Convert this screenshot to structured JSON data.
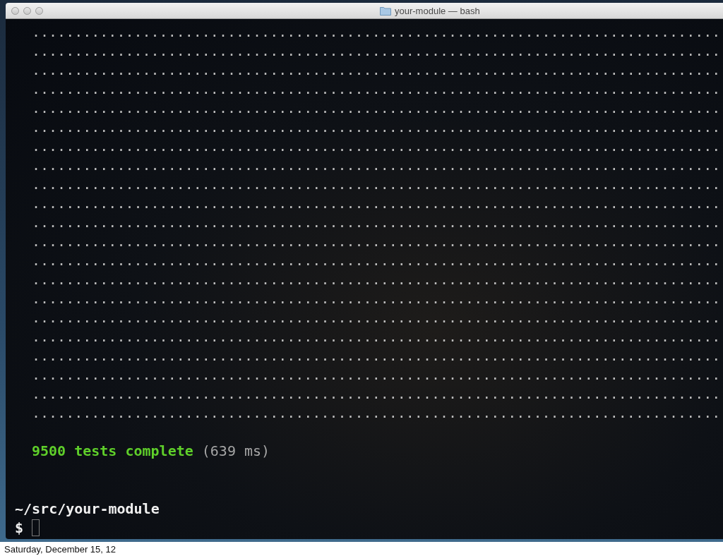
{
  "window": {
    "title": "your-module — bash"
  },
  "terminal": {
    "output_lines": [
      ".................................................................................",
      ".................................................................................",
      ".................................................................................",
      ".................................................................................",
      ".................................................................................",
      ".................................................................................",
      ".................................................................................",
      ".................................................................................",
      ".................................................................................",
      ".................................................................................",
      ".................................................................................",
      ".................................................................................",
      ".................................................................................",
      ".................................................................................",
      ".................................................................................",
      ".................................................................................",
      ".................................................................................",
      ".................................................................................",
      ".................................................................................",
      ".................................................................................",
      "................................................................................."
    ],
    "result": {
      "summary": "9500 tests complete",
      "timing": "(639 ms)"
    },
    "prompt": {
      "path": "~/src/your-module",
      "symbol": "$"
    }
  },
  "footer": {
    "date": "Saturday, December 15, 12"
  }
}
